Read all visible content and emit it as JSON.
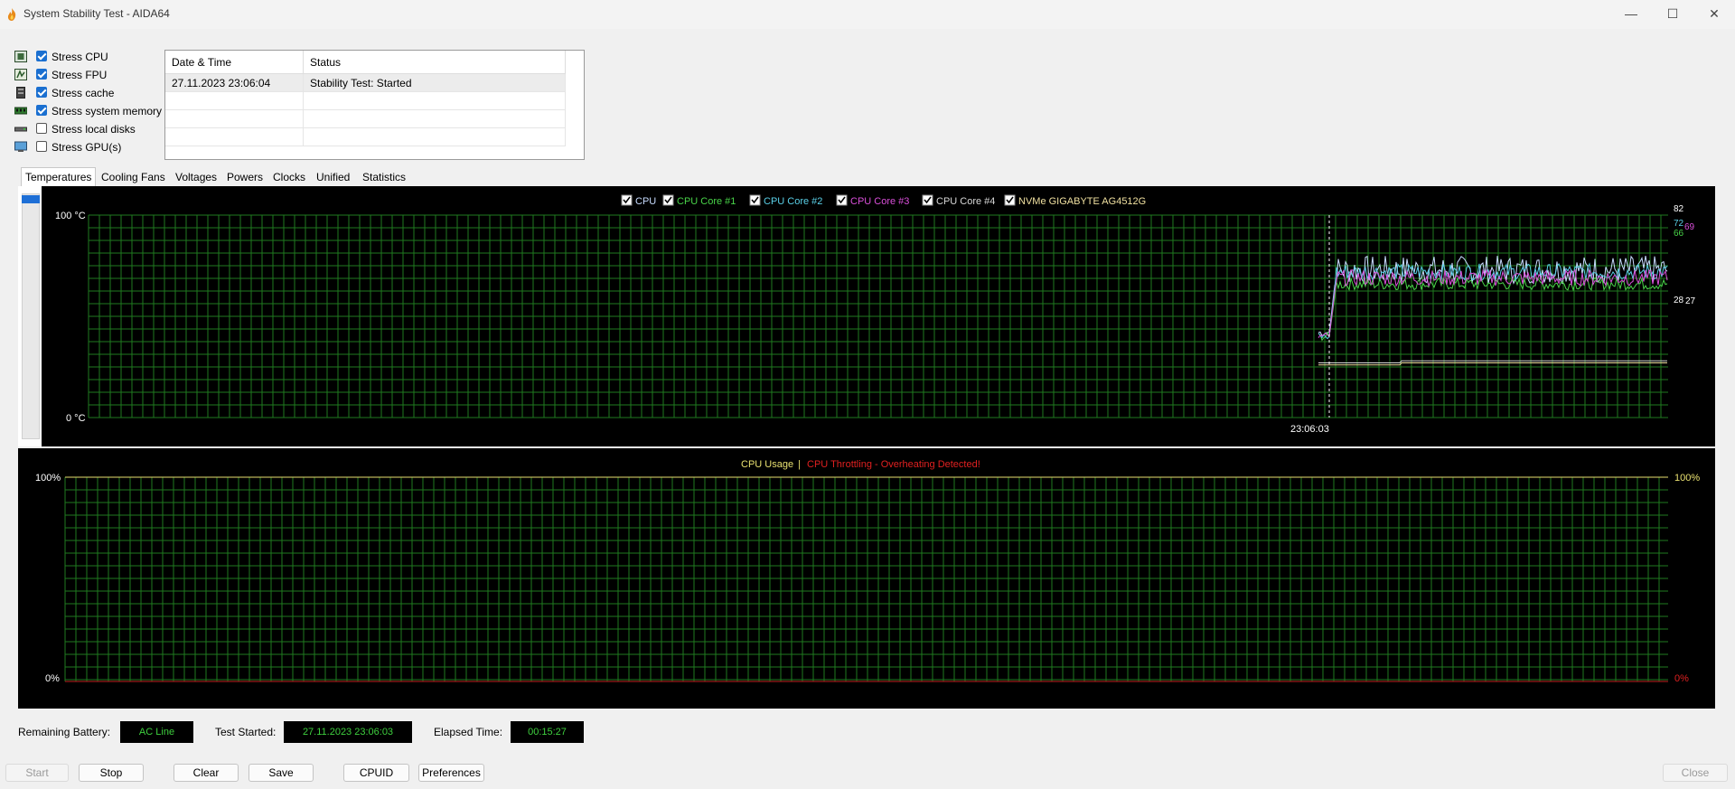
{
  "window": {
    "title": "System Stability Test - AIDA64",
    "minimize_glyph": "—",
    "maximize_glyph": "☐",
    "close_glyph": "✕"
  },
  "stress_options": [
    {
      "label": "Stress CPU",
      "checked": true,
      "icon": "cpu-icon"
    },
    {
      "label": "Stress FPU",
      "checked": true,
      "icon": "fpu-icon"
    },
    {
      "label": "Stress cache",
      "checked": true,
      "icon": "cache-icon"
    },
    {
      "label": "Stress system memory",
      "checked": true,
      "icon": "memory-icon"
    },
    {
      "label": "Stress local disks",
      "checked": false,
      "icon": "disk-icon"
    },
    {
      "label": "Stress GPU(s)",
      "checked": false,
      "icon": "gpu-icon"
    }
  ],
  "log": {
    "columns": [
      "Date & Time",
      "Status"
    ],
    "rows": [
      {
        "datetime": "27.11.2023 23:06:04",
        "status": "Stability Test: Started"
      }
    ]
  },
  "tabs": [
    "Temperatures",
    "Cooling Fans",
    "Voltages",
    "Powers",
    "Clocks",
    "Unified",
    "Statistics"
  ],
  "active_tab": "Temperatures",
  "temperature_chart": {
    "legend": [
      {
        "name": "CPU",
        "color": "#c8dcff",
        "checked": true
      },
      {
        "name": "CPU Core #1",
        "color": "#49d449",
        "checked": true
      },
      {
        "name": "CPU Core #2",
        "color": "#5ad0e8",
        "checked": true
      },
      {
        "name": "CPU Core #3",
        "color": "#d94fd9",
        "checked": true
      },
      {
        "name": "CPU Core #4",
        "color": "#d8d8d8",
        "checked": true
      },
      {
        "name": "NVMe GIGABYTE AG4512G",
        "color": "#f0e0a0",
        "checked": true
      }
    ],
    "y_top_label": "100 °C",
    "y_bottom_label": "0 °C",
    "y_range": [
      0,
      100
    ],
    "time_marker": "23:06:03",
    "right_values": [
      {
        "text": "82",
        "value": 82,
        "color": "#ffffff"
      },
      {
        "text": "72",
        "value": 72,
        "color": "#5ad0e8"
      },
      {
        "text": "69",
        "value": 69,
        "color": "#d94fd9"
      },
      {
        "text": "66",
        "value": 66,
        "color": "#49d449"
      },
      {
        "text": "28",
        "value": 28,
        "color": "#ffffff"
      },
      {
        "text": "27",
        "value": 27,
        "color": "#ffffff"
      }
    ]
  },
  "usage_chart": {
    "title_left": "CPU Usage",
    "separator": "|",
    "title_right": "CPU Throttling - Overheating Detected!",
    "left_top": "100%",
    "left_bottom": "0%",
    "right_top": "100%",
    "right_bottom": "0%"
  },
  "status": {
    "battery_label": "Remaining Battery:",
    "battery_value": "AC Line",
    "started_label": "Test Started:",
    "started_value": "27.11.2023 23:06:03",
    "elapsed_label": "Elapsed Time:",
    "elapsed_value": "00:15:27"
  },
  "buttons": {
    "start": "Start",
    "stop": "Stop",
    "clear": "Clear",
    "save": "Save",
    "cpuid": "CPUID",
    "preferences": "Preferences",
    "close": "Close"
  },
  "colors": {
    "grid": "#1f7a1f",
    "usage_label": "#e8e070",
    "throttle_label": "#e02020",
    "usage_zero_line": "#c02020"
  }
}
